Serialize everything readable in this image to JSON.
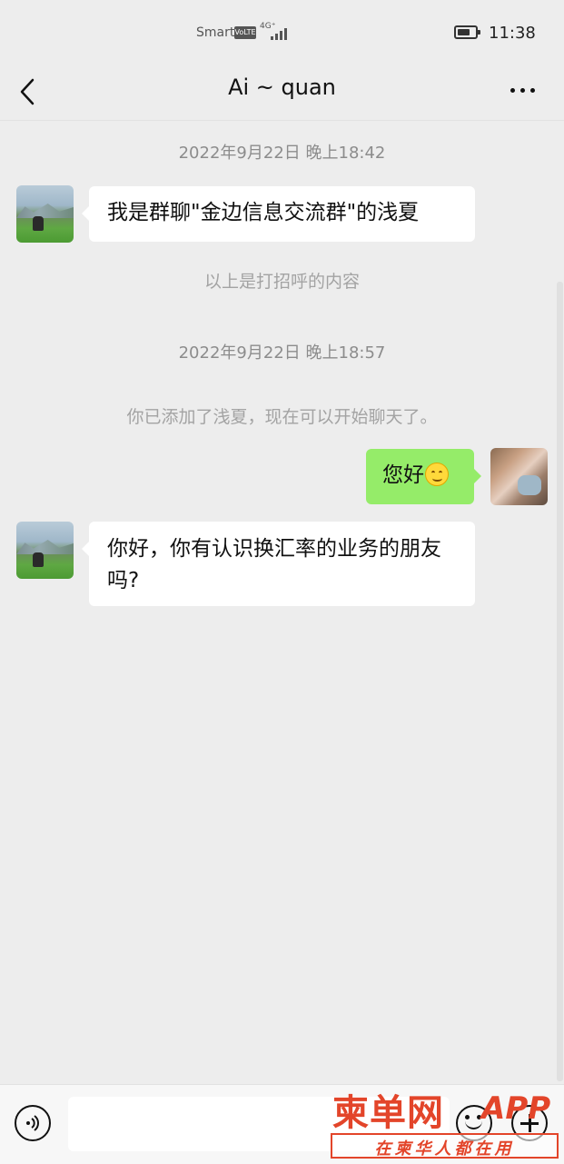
{
  "status_bar": {
    "carrier": "Smart",
    "volte": "VoLTE",
    "network": "4G⁺",
    "battery_level": 0.7,
    "time": "11:38"
  },
  "header": {
    "title": "Ai ~ quan",
    "back_icon": "chevron-left-icon",
    "more_icon": "more-dots-icon"
  },
  "messages": {
    "ts1": "2022年9月22日 晚上18:42",
    "m1": "我是群聊\"金边信息交流群\"的浅夏",
    "sys1": "以上是打招呼的内容",
    "ts2": "2022年9月22日 晚上18:57",
    "sys2": "你已添加了浅夏，现在可以开始聊天了。",
    "m2": "您好",
    "m3": "你好，你有认识换汇率的业务的朋友吗?"
  },
  "input_bar": {
    "placeholder": "",
    "voice_icon": "voice-icon",
    "emoji_icon": "emoji-icon",
    "plus_icon": "plus-icon"
  },
  "watermark": {
    "brand": "柬单网",
    "app": "APP",
    "tagline": "在柬华人都在用"
  },
  "colors": {
    "background": "#ededed",
    "outgoing_bubble": "#95ec69",
    "incoming_bubble": "#ffffff",
    "watermark": "#e3452a"
  }
}
